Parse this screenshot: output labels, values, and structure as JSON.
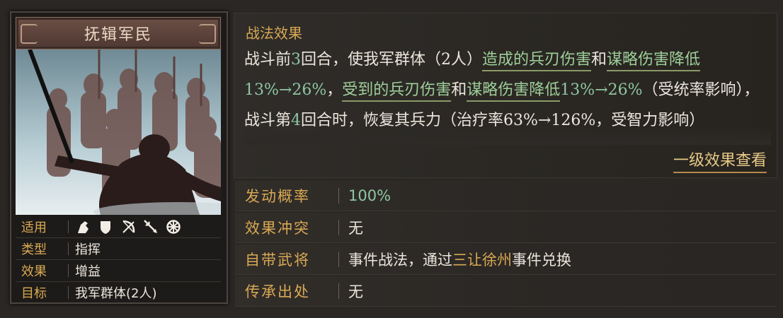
{
  "card": {
    "title": "抚辑军民",
    "props": [
      {
        "label": "适用",
        "icons": [
          "cavalry-icon",
          "shield-icon",
          "bow-icon",
          "spear-icon",
          "siege-icon"
        ]
      },
      {
        "label": "类型",
        "value": "指挥"
      },
      {
        "label": "效果",
        "value": "增益"
      },
      {
        "label": "目标",
        "value": "我军群体(2人)"
      }
    ]
  },
  "panel": {
    "title": "战法效果",
    "effect_segments": [
      {
        "t": "战斗前",
        "s": "n"
      },
      {
        "t": "3",
        "s": "num"
      },
      {
        "t": "回合，使我军群体（2人）",
        "s": "n"
      },
      {
        "t": "造成的兵刃伤害",
        "s": "u"
      },
      {
        "t": "和",
        "s": "n"
      },
      {
        "t": "谋略伤害降低",
        "s": "u"
      },
      {
        "t": "13%→26%",
        "s": "num"
      },
      {
        "t": "，",
        "s": "n"
      },
      {
        "t": "受到的兵刃伤害",
        "s": "u"
      },
      {
        "t": "和",
        "s": "n"
      },
      {
        "t": "谋略伤害降低",
        "s": "u"
      },
      {
        "t": "13%→26%",
        "s": "num"
      },
      {
        "t": "（受统率影响），战斗第",
        "s": "n"
      },
      {
        "t": "4",
        "s": "num"
      },
      {
        "t": "回合时，恢复其兵力",
        "s": "n"
      },
      {
        "t": "（治疗率63%→126%，受智力影响）",
        "s": "n"
      }
    ],
    "more_link": "一级效果查看"
  },
  "info": [
    {
      "label": "发动概率",
      "value": "100%",
      "green": true
    },
    {
      "label": "效果冲突",
      "value": "无"
    },
    {
      "label": "自带武将",
      "segments": [
        {
          "t": "事件战法，通过",
          "s": "n"
        },
        {
          "t": "三让徐州",
          "s": "gold"
        },
        {
          "t": "事件兑换",
          "s": "n"
        }
      ]
    },
    {
      "label": "传承出处",
      "value": "无"
    }
  ],
  "colors": {
    "accent_gold": "#d9a954",
    "green": "#8fc6a0",
    "text": "#ece6dc"
  }
}
